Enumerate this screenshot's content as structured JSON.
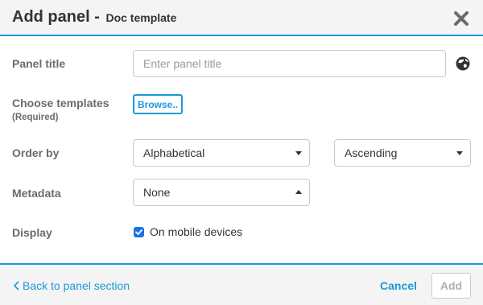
{
  "dialog": {
    "title": "Add panel",
    "separator": " - ",
    "subtitle": "Doc template",
    "close_icon": "close-icon"
  },
  "form": {
    "panel_title": {
      "label": "Panel title",
      "placeholder": "Enter panel title",
      "value": "",
      "icon": "globe-icon"
    },
    "templates": {
      "label": "Choose templates",
      "required_note": "(Required)",
      "browse_label": "Browse.."
    },
    "order_by": {
      "label": "Order by",
      "field_value": "Alphabetical",
      "direction_value": "Ascending"
    },
    "metadata": {
      "label": "Metadata",
      "value": "None"
    },
    "display": {
      "label": "Display",
      "checkbox_label": "On mobile devices",
      "checked": true
    }
  },
  "footer": {
    "back_label": "Back to panel section",
    "cancel_label": "Cancel",
    "add_label": "Add"
  },
  "colors": {
    "accent": "#1a9ad6",
    "checkbox": "#1a73e8",
    "header_bg": "#f4f4f4",
    "label": "#6b6b6b"
  }
}
